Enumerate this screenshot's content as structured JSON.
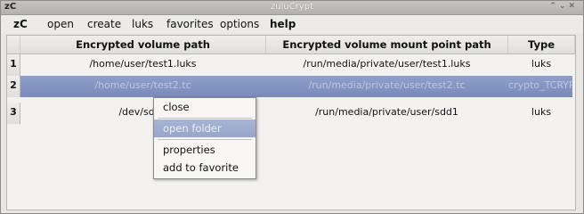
{
  "window": {
    "app_icon": "zC",
    "title": "zuluCrypt"
  },
  "menubar": {
    "items": [
      {
        "label": "zC"
      },
      {
        "label": "open"
      },
      {
        "label": "create"
      },
      {
        "label": "luks"
      },
      {
        "label": "favorites"
      },
      {
        "label": "options"
      },
      {
        "label": "help"
      }
    ]
  },
  "table": {
    "headers": [
      "Encrypted volume path",
      "Encrypted volume mount point path",
      "Type"
    ],
    "rows": [
      {
        "num": "1",
        "path": "/home/user/test1.luks",
        "mount": "/run/media/private/user/test1.luks",
        "type": "luks"
      },
      {
        "num": "2",
        "path": "/home/user/test2.tc",
        "mount": "/run/media/private/user/test2.tc",
        "type": "crypto_TCRYPT"
      },
      {
        "num": "3",
        "path": "/dev/sdd1",
        "mount": "/run/media/private/user/sdd1",
        "type": "luks"
      }
    ]
  },
  "context_menu": {
    "items": [
      {
        "label": "close"
      },
      {
        "label": "open folder"
      },
      {
        "label": "properties"
      },
      {
        "label": "add to favorite"
      }
    ]
  },
  "colors": {
    "selection": "#7f90bf",
    "window_bg": "#e9e7e4"
  }
}
